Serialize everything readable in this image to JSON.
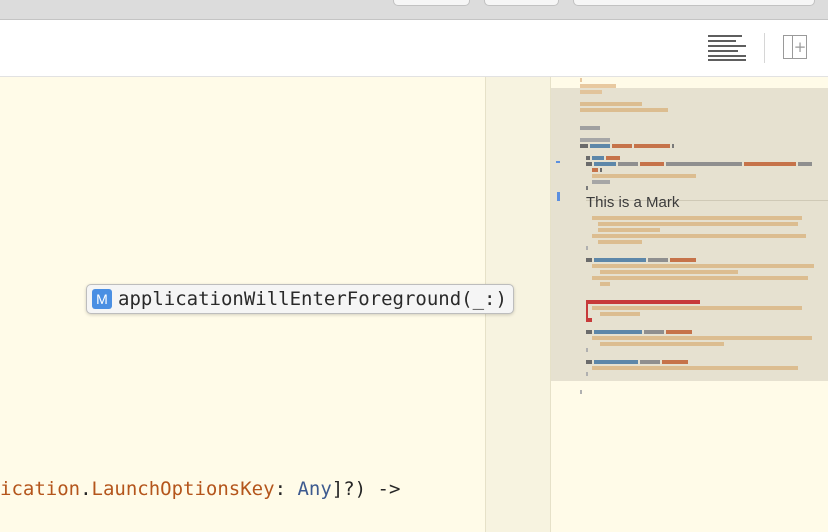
{
  "popup": {
    "badge": "M",
    "label": "applicationWillEnterForeground(_:)"
  },
  "code_line": {
    "part1": "ication",
    "dot": ".",
    "type": "LaunchOptionsKey",
    "colon": ": ",
    "keyword": "Any",
    "rest": "]?) ->"
  },
  "minimap": {
    "mark_label": "This is a Mark"
  },
  "colors": {
    "editor_background": "#fffbe8",
    "type_color": "#b4551b",
    "keyword_color": "#3d5a8f",
    "badge_color": "#4a8fe3",
    "mark_highlight": "#c73a3a"
  },
  "icons": {
    "lines": "lines-icon",
    "add_editor": "add-editor-icon"
  }
}
